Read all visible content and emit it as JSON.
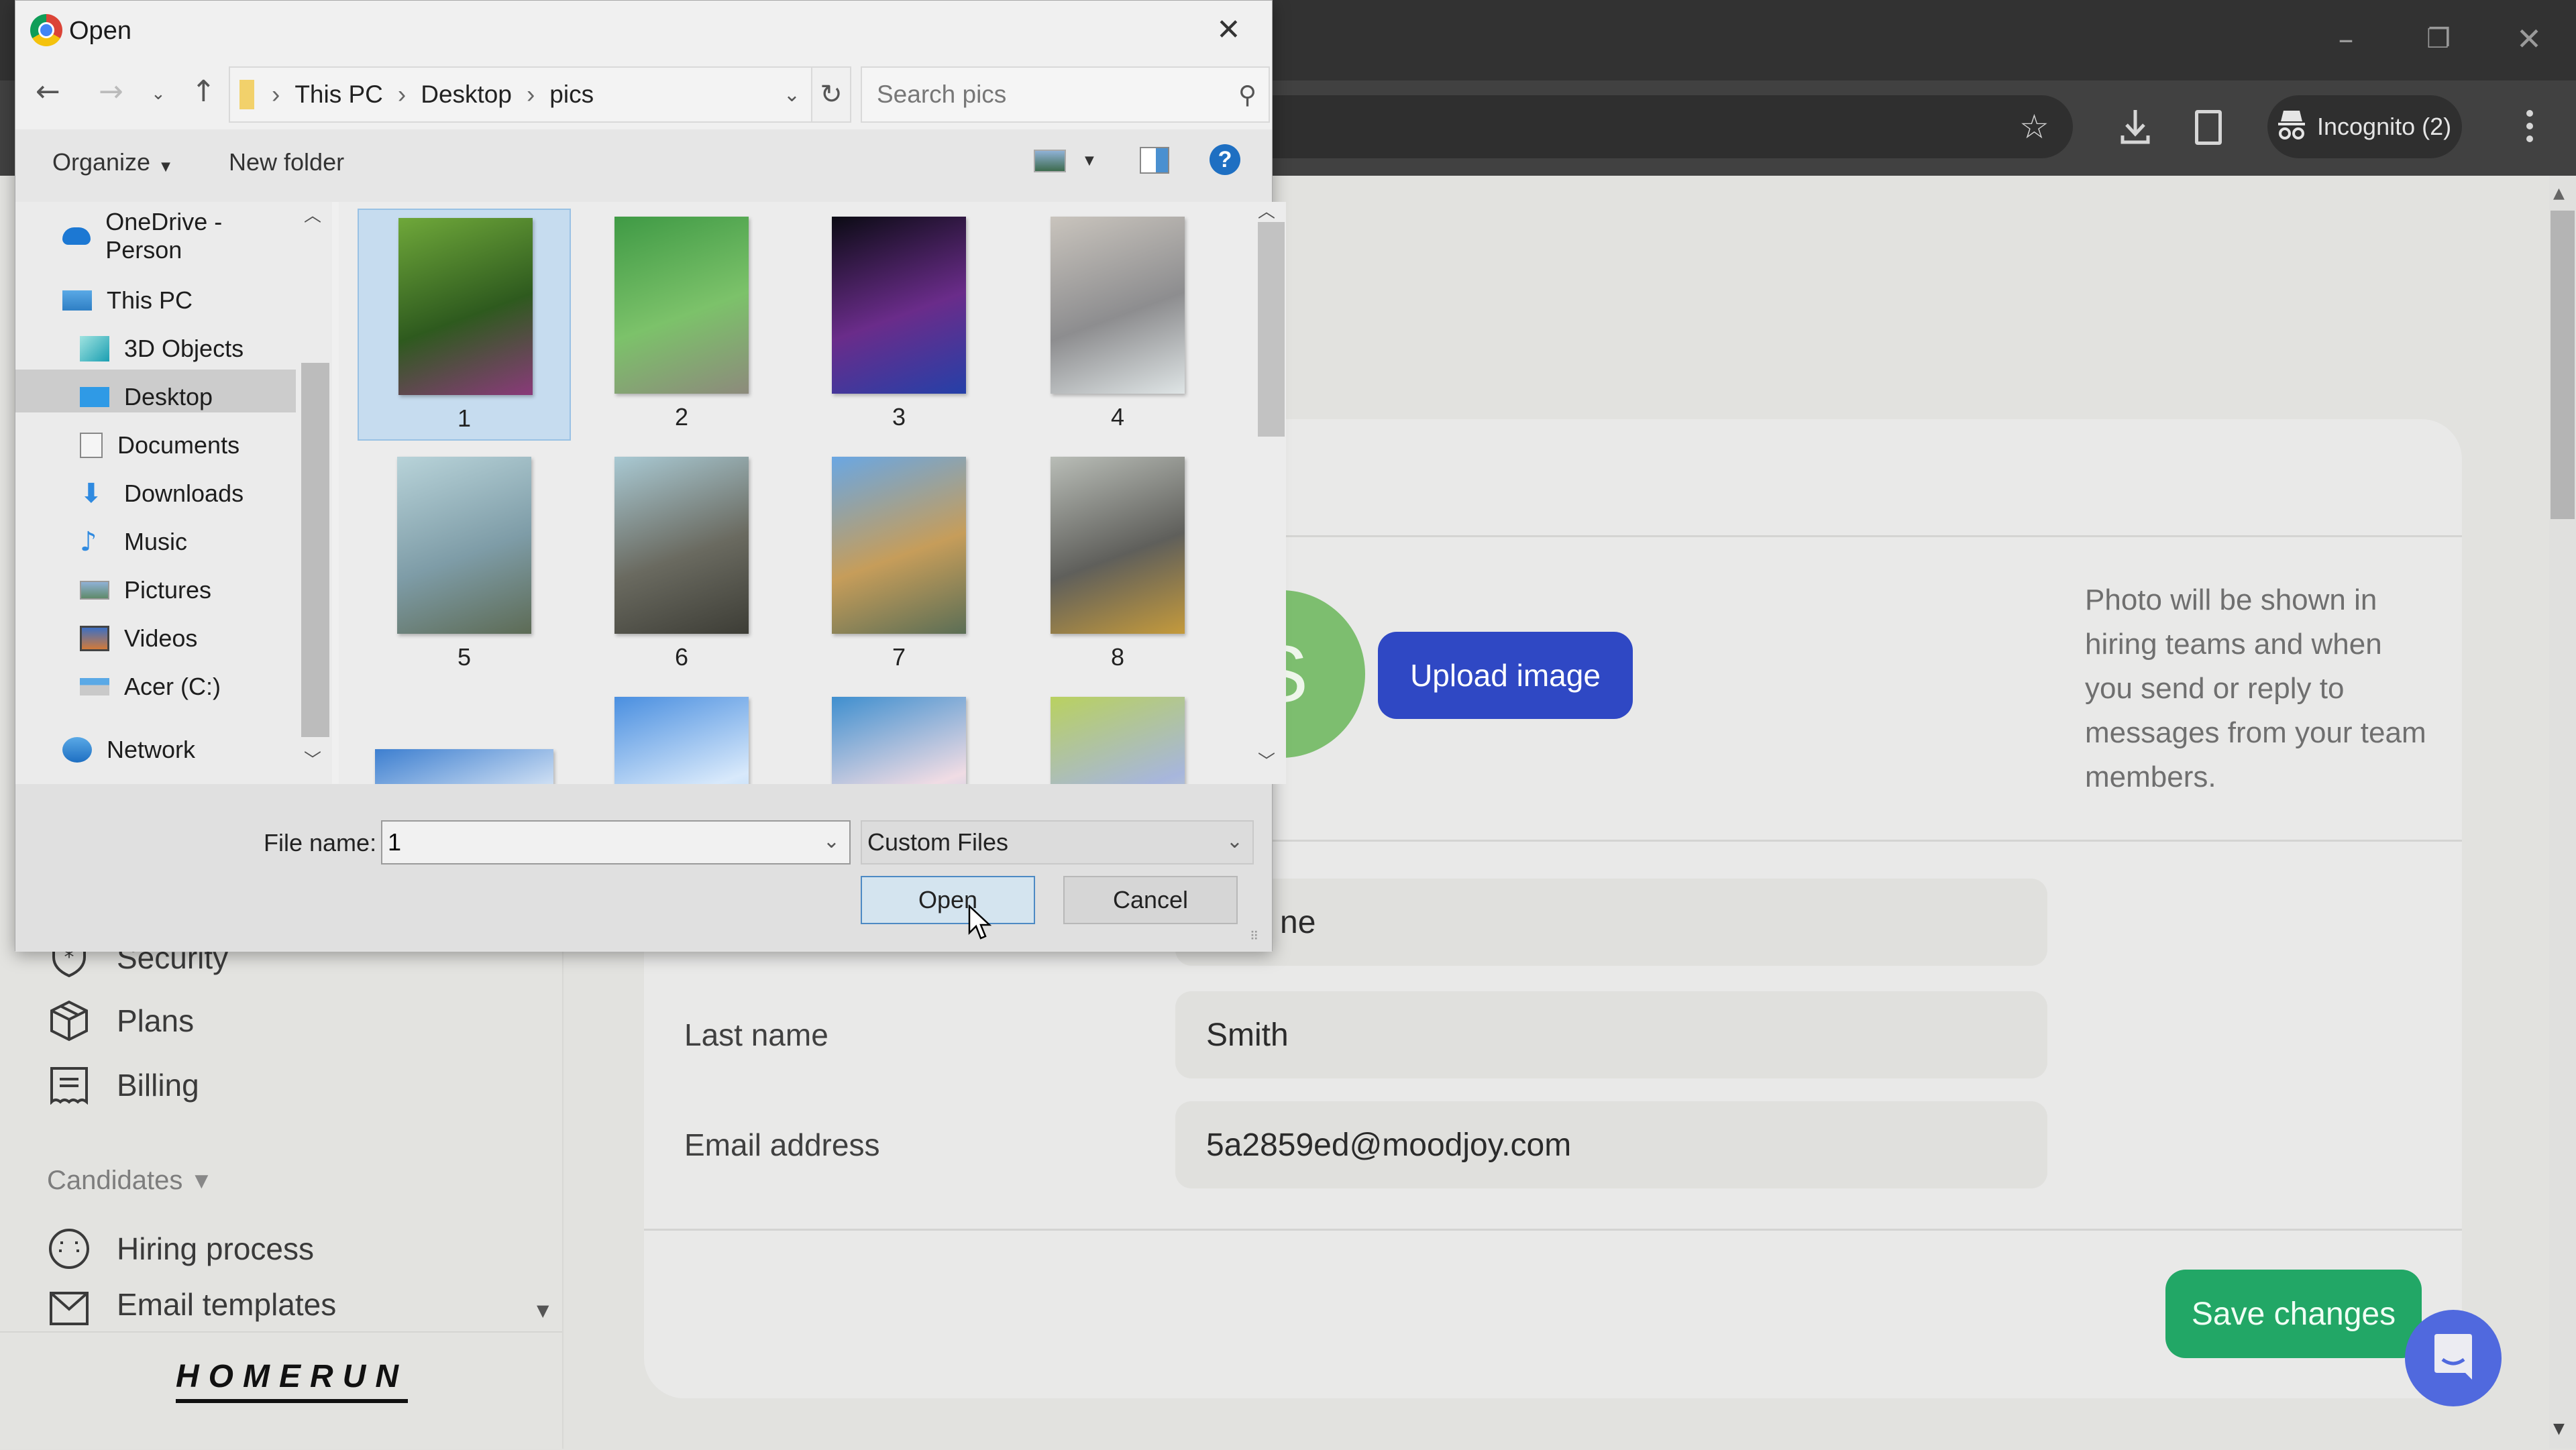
{
  "browser": {
    "window_controls": {
      "minimize": "–",
      "restore": "❐",
      "close": "✕"
    },
    "toolbar": {
      "incognito_label": "Incognito (2)"
    }
  },
  "dialog": {
    "title": "Open",
    "breadcrumb": [
      "This PC",
      "Desktop",
      "pics"
    ],
    "search_placeholder": "Search pics",
    "organize_label": "Organize",
    "new_folder_label": "New folder",
    "nav_tree": [
      {
        "label": "OneDrive - Person",
        "icon": "onedrive-cloud-icon",
        "level": 0
      },
      {
        "label": "This PC",
        "icon": "computer-icon",
        "level": 0
      },
      {
        "label": "3D Objects",
        "icon": "3d-objects-icon",
        "level": 1
      },
      {
        "label": "Desktop",
        "icon": "desktop-icon",
        "level": 1,
        "selected": true
      },
      {
        "label": "Documents",
        "icon": "documents-icon",
        "level": 1
      },
      {
        "label": "Downloads",
        "icon": "downloads-icon",
        "level": 1
      },
      {
        "label": "Music",
        "icon": "music-note-icon",
        "level": 1
      },
      {
        "label": "Pictures",
        "icon": "pictures-icon",
        "level": 1
      },
      {
        "label": "Videos",
        "icon": "videos-icon",
        "level": 1
      },
      {
        "label": "Acer (C:)",
        "icon": "drive-icon",
        "level": 1
      },
      {
        "label": "Network",
        "icon": "network-icon",
        "level": 0
      }
    ],
    "files": [
      {
        "name": "1",
        "selected": true,
        "colors": [
          "#6fa83a",
          "#2e5a1e",
          "#8a3a7a"
        ]
      },
      {
        "name": "2",
        "colors": [
          "#3f9a45",
          "#7cc26a",
          "#8d8a7c"
        ]
      },
      {
        "name": "3",
        "colors": [
          "#0b0b14",
          "#6a2c8a",
          "#2540a8"
        ]
      },
      {
        "name": "4",
        "colors": [
          "#c9c4bd",
          "#8d8d8f",
          "#dfe5e6"
        ]
      },
      {
        "name": "5",
        "colors": [
          "#b8d3d9",
          "#7e9ca7",
          "#5d6b55"
        ]
      },
      {
        "name": "6",
        "colors": [
          "#a9c9d3",
          "#6a6a60",
          "#3d3d36"
        ]
      },
      {
        "name": "7",
        "colors": [
          "#6aa7e3",
          "#c69d5a",
          "#5b6e55"
        ]
      },
      {
        "name": "8",
        "colors": [
          "#b9bdb7",
          "#5f5f5b",
          "#c49a3c"
        ]
      },
      {
        "name": "",
        "colors": [
          "#3d7fd0",
          "#ffffff",
          "#8fb6e6"
        ]
      },
      {
        "name": "",
        "colors": [
          "#4a8fe0",
          "#d8e9fb",
          "#8cbdf2"
        ]
      },
      {
        "name": "",
        "colors": [
          "#3f8fcf",
          "#f0dce4",
          "#7ab6de"
        ]
      },
      {
        "name": "",
        "colors": [
          "#b9d160",
          "#a7b6dc",
          "#e6eab8"
        ]
      }
    ],
    "file_name_label": "File name:",
    "file_name_value": "1",
    "file_type_value": "Custom Files",
    "open_label": "Open",
    "cancel_label": "Cancel"
  },
  "sidebar": {
    "items_top": [
      {
        "label": "Security",
        "icon": "shield-star-icon"
      },
      {
        "label": "Plans",
        "icon": "box-icon"
      },
      {
        "label": "Billing",
        "icon": "receipt-icon"
      }
    ],
    "section_heading": "Candidates",
    "items_candidates": [
      {
        "label": "Hiring process",
        "icon": "baseball-icon"
      },
      {
        "label": "Email templates",
        "icon": "envelope-icon"
      }
    ],
    "logo": "HOMERUN"
  },
  "profile": {
    "avatar_initial": "S",
    "upload_label": "Upload image",
    "photo_help": "Photo will be shown in hiring teams and when you send or reply to messages from your team members.",
    "first_name_visible_fragment": "ne",
    "fields": [
      {
        "label": "Last name",
        "value": "Smith"
      },
      {
        "label": "Email address",
        "value": "5a2859ed@moodjoy.com"
      }
    ],
    "save_label": "Save changes"
  },
  "colors": {
    "upload_button": "#2f48c4",
    "save_button": "#22a766",
    "avatar": "#7dbe6f",
    "chat_bubble": "#5069de"
  }
}
